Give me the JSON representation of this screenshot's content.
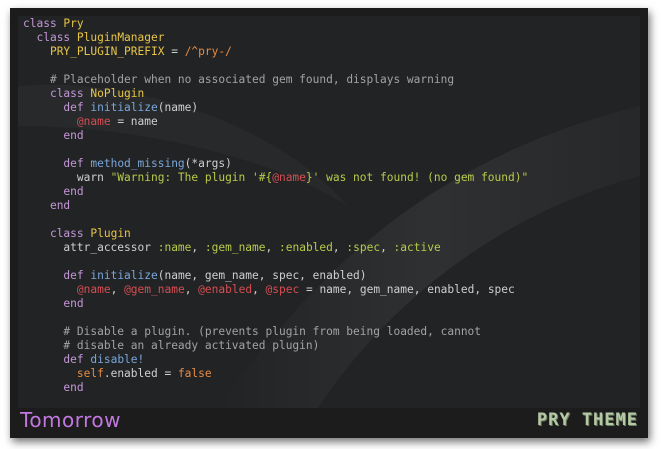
{
  "theme": {
    "name": "Tomorrow",
    "logo_text": "PRY THEME"
  },
  "colors": {
    "keyword": "#c397d8",
    "constant": "#e7c547",
    "comment": "#a3a3a3",
    "instance_var": "#d54e53",
    "method": "#7aa6da",
    "string": "#b9ca4a",
    "symbol": "#e78c45",
    "plain": "#cfcfcf"
  },
  "code": {
    "lines": [
      [
        [
          "k",
          "class "
        ],
        [
          "c",
          "Pry"
        ]
      ],
      [
        [
          "pl",
          "  "
        ],
        [
          "k",
          "class "
        ],
        [
          "c",
          "PluginManager"
        ]
      ],
      [
        [
          "pl",
          "    "
        ],
        [
          "c",
          "PRY_PLUGIN_PREFIX"
        ],
        [
          "pl",
          " = "
        ],
        [
          "sy",
          "/^pry-/"
        ]
      ],
      [],
      [
        [
          "pl",
          "    "
        ],
        [
          "cm",
          "# Placeholder when no associated gem found, displays warning"
        ]
      ],
      [
        [
          "pl",
          "    "
        ],
        [
          "k",
          "class "
        ],
        [
          "c",
          "NoPlugin"
        ]
      ],
      [
        [
          "pl",
          "      "
        ],
        [
          "k",
          "def "
        ],
        [
          "m",
          "initialize"
        ],
        [
          "pl",
          "(name)"
        ]
      ],
      [
        [
          "pl",
          "        "
        ],
        [
          "iv",
          "@name"
        ],
        [
          "pl",
          " = name"
        ]
      ],
      [
        [
          "pl",
          "      "
        ],
        [
          "k",
          "end"
        ]
      ],
      [],
      [
        [
          "pl",
          "      "
        ],
        [
          "k",
          "def "
        ],
        [
          "m",
          "method_missing"
        ],
        [
          "pl",
          "(*args)"
        ]
      ],
      [
        [
          "pl",
          "        warn "
        ],
        [
          "s",
          "\"Warning: The plugin '#{"
        ],
        [
          "iv",
          "@name"
        ],
        [
          "s",
          "}' was not found! (no gem found)\""
        ]
      ],
      [
        [
          "pl",
          "      "
        ],
        [
          "k",
          "end"
        ]
      ],
      [
        [
          "pl",
          "    "
        ],
        [
          "k",
          "end"
        ]
      ],
      [],
      [
        [
          "pl",
          "    "
        ],
        [
          "k",
          "class "
        ],
        [
          "c",
          "Plugin"
        ]
      ],
      [
        [
          "pl",
          "      attr_accessor "
        ],
        [
          "s",
          ":name"
        ],
        [
          "pl",
          ", "
        ],
        [
          "s",
          ":gem_name"
        ],
        [
          "pl",
          ", "
        ],
        [
          "s",
          ":enabled"
        ],
        [
          "pl",
          ", "
        ],
        [
          "s",
          ":spec"
        ],
        [
          "pl",
          ", "
        ],
        [
          "s",
          ":active"
        ]
      ],
      [],
      [
        [
          "pl",
          "      "
        ],
        [
          "k",
          "def "
        ],
        [
          "m",
          "initialize"
        ],
        [
          "pl",
          "(name, gem_name, spec, enabled)"
        ]
      ],
      [
        [
          "pl",
          "        "
        ],
        [
          "iv",
          "@name"
        ],
        [
          "pl",
          ", "
        ],
        [
          "iv",
          "@gem_name"
        ],
        [
          "pl",
          ", "
        ],
        [
          "iv",
          "@enabled"
        ],
        [
          "pl",
          ", "
        ],
        [
          "iv",
          "@spec"
        ],
        [
          "pl",
          " = name, gem_name, enabled, spec"
        ]
      ],
      [
        [
          "pl",
          "      "
        ],
        [
          "k",
          "end"
        ]
      ],
      [],
      [
        [
          "pl",
          "      "
        ],
        [
          "cm",
          "# Disable a plugin. (prevents plugin from being loaded, cannot"
        ]
      ],
      [
        [
          "pl",
          "      "
        ],
        [
          "cm",
          "# disable an already activated plugin)"
        ]
      ],
      [
        [
          "pl",
          "      "
        ],
        [
          "k",
          "def "
        ],
        [
          "m",
          "disable!"
        ]
      ],
      [
        [
          "pl",
          "        "
        ],
        [
          "sy",
          "self"
        ],
        [
          "pl",
          ".enabled = "
        ],
        [
          "sy",
          "false"
        ]
      ],
      [
        [
          "pl",
          "      "
        ],
        [
          "k",
          "end"
        ]
      ]
    ]
  }
}
